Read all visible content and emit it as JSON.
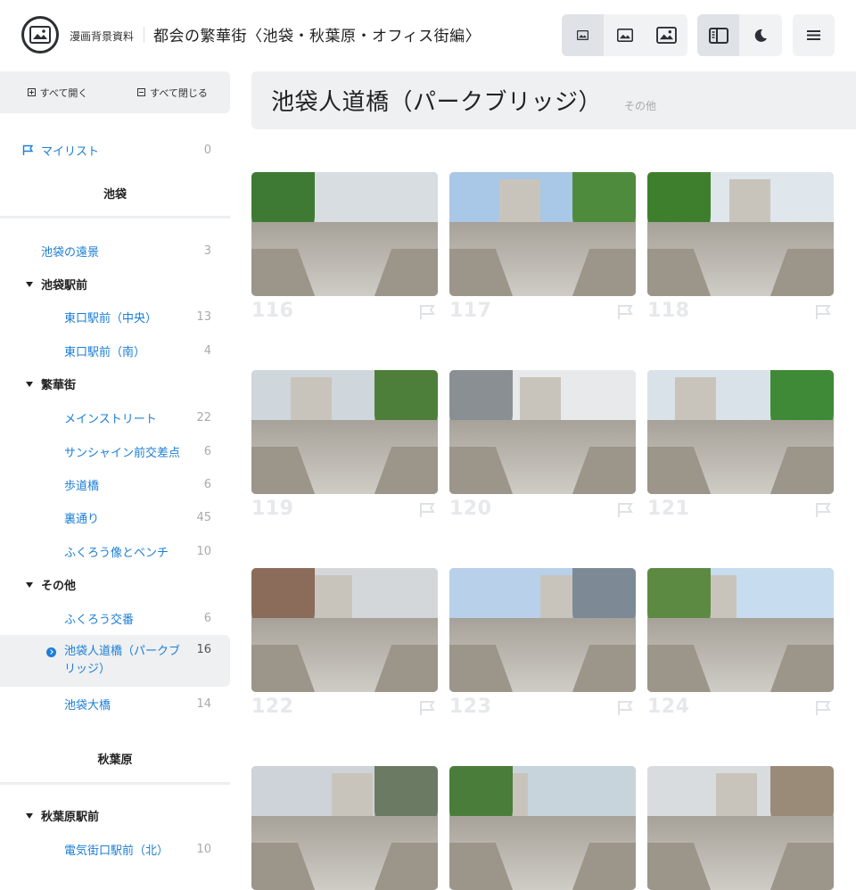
{
  "header": {
    "site_name": "漫画背景資料",
    "title": "都会の繁華街〈池袋・秋葉原・オフィス街編〉",
    "icons": [
      "logo-image-icon",
      "image-small-icon",
      "image-medium-icon",
      "image-large-icon",
      "sidebar-toggle-icon",
      "dark-mode-icon",
      "menu-icon"
    ]
  },
  "sidebar": {
    "expand_all": "すべて開く",
    "collapse_all": "すべて閉じる",
    "mylist": {
      "label": "マイリスト",
      "count": "0"
    },
    "sections": [
      {
        "title": "池袋"
      },
      {
        "title": "秋葉原"
      }
    ],
    "items": [
      {
        "label": "池袋の遠景",
        "count": "3"
      },
      {
        "label": "池袋駅前"
      },
      {
        "label": "東口駅前（中央）",
        "count": "13"
      },
      {
        "label": "東口駅前（南）",
        "count": "4"
      },
      {
        "label": "繁華街"
      },
      {
        "label": "メインストリート",
        "count": "22"
      },
      {
        "label": "サンシャイン前交差点",
        "count": "6"
      },
      {
        "label": "歩道橋",
        "count": "6"
      },
      {
        "label": "裏通り",
        "count": "45"
      },
      {
        "label": "ふくろう像とベンチ",
        "count": "10"
      },
      {
        "label": "その他"
      },
      {
        "label": "ふくろう交番",
        "count": "6"
      },
      {
        "label": "池袋人道橋（パークブリッジ）",
        "count": "16"
      },
      {
        "label": "池袋大橋",
        "count": "14"
      },
      {
        "label": "秋葉原駅前"
      },
      {
        "label": "電気街口駅前（北）",
        "count": "10"
      }
    ]
  },
  "main": {
    "title": "池袋人道橋（パークブリッジ）",
    "category": "その他",
    "photos": [
      {
        "number": "116"
      },
      {
        "number": "117"
      },
      {
        "number": "118"
      },
      {
        "number": "119"
      },
      {
        "number": "120"
      },
      {
        "number": "121"
      },
      {
        "number": "122"
      },
      {
        "number": "123"
      },
      {
        "number": "124"
      },
      {
        "number": ""
      },
      {
        "number": ""
      },
      {
        "number": ""
      }
    ]
  },
  "colors": {
    "accent": "#1c7ed6",
    "panel": "#eef0f2",
    "number": "#e6e8eb"
  }
}
